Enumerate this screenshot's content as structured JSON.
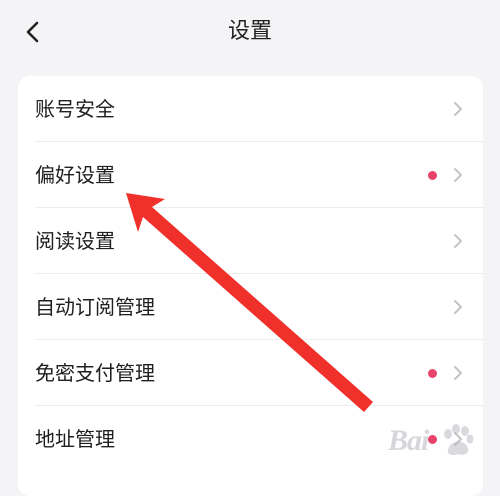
{
  "header": {
    "title": "设置",
    "back_icon": "chevron-left-icon"
  },
  "settings": {
    "items": [
      {
        "label": "账号安全",
        "has_dot": false,
        "chevron_icon": "chevron-right-icon"
      },
      {
        "label": "偏好设置",
        "has_dot": true,
        "chevron_icon": "chevron-right-icon"
      },
      {
        "label": "阅读设置",
        "has_dot": false,
        "chevron_icon": "chevron-right-icon"
      },
      {
        "label": "自动订阅管理",
        "has_dot": false,
        "chevron_icon": "chevron-right-icon"
      },
      {
        "label": "免密支付管理",
        "has_dot": true,
        "chevron_icon": "chevron-right-icon"
      },
      {
        "label": "地址管理",
        "has_dot": true,
        "chevron_icon": "chevron-right-icon"
      }
    ],
    "dot_color": "#e8436a"
  },
  "annotation": {
    "arrow_color": "#f0302a",
    "arrow_icon": "red-arrow-annotation"
  },
  "watermark": {
    "text": "Bai",
    "icon": "baidu-watermark-icon"
  }
}
